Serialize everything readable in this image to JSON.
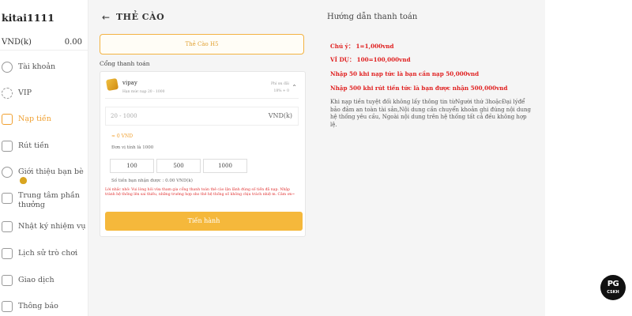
{
  "user": {
    "username": "kitai1111",
    "currency": "VND(k)",
    "balance": "0.00"
  },
  "sidebar": {
    "items": [
      {
        "label": "Tài khoản",
        "icon": "user-icon"
      },
      {
        "label": "VIP",
        "icon": "vip-gear-icon"
      },
      {
        "label": "Nạp tiền",
        "icon": "deposit-icon",
        "active": true
      },
      {
        "label": "Rút tiền",
        "icon": "withdraw-icon"
      },
      {
        "label": "Giới thiệu bạn bè",
        "icon": "referral-icon"
      },
      {
        "label": "Trung tâm phần thưởng",
        "icon": "reward-center-icon"
      },
      {
        "label": "Nhật ký nhiệm vụ",
        "icon": "mission-log-icon"
      },
      {
        "label": "Lịch sử trò chơi",
        "icon": "game-history-icon"
      },
      {
        "label": "Giao dịch",
        "icon": "transaction-icon"
      },
      {
        "label": "Thông báo",
        "icon": "mail-icon"
      }
    ]
  },
  "deposit": {
    "title": "THẺ CÀO",
    "method": "Thẻ Cào H5",
    "gateway_label": "Cổng thanh toán",
    "gateway": {
      "name": "vipay",
      "limit": "Hạn mức nạp 20 - 1000",
      "rate_label": "Phí ưu đãi",
      "rate_value": "18% + 0"
    },
    "amount_placeholder": "20 - 1000",
    "amount_unit": "VND(k)",
    "calc": "≈ 0 VND",
    "unit_note": "Đơn vị tính là 1000",
    "quick_amounts": [
      "100",
      "500",
      "1000"
    ],
    "receive": "Số tiền bạn nhận được : 0.00 VND(k)",
    "warning": "Lời nhắc nhở: Vui lòng hỏi vừa tham gia cổng thanh toán thẻ cào lận lãnh đúng số tiền đã nạp. Nhập tránh hệ thống lên sai thiếu, những trường hợp sho thẻ hệ thống số không chịu trách nhiệ m. Cảm ơn~",
    "submit": "Tiến hành"
  },
  "guide": {
    "title": "Hướng dẫn thanh toán",
    "lines": [
      "Chú ý： 1=1,000vnd",
      "VÍ DỤ： 100=100,000vnd",
      "Nhập 50 khi nạp tức là bạn cần nạp 50,000vnd",
      "Nhập 500 khi rút tiền tức là bạn được nhận 500,000vnd"
    ],
    "body": "Khi nạp tiền tuyệt đối không lấy thông tin từNgười thứ 3hoặcĐại lýđể bảo đảm an toàn tài sản,Nội dung cần chuyển khoản ghi đúng nội dung hệ thống yêu cầu, Ngoài nội dung trên hệ thống tất cả đều không hợp lệ."
  },
  "support": {
    "badge": "PG",
    "label": "CSKH"
  },
  "colors": {
    "accent": "#f5b83b",
    "warning": "#e02020"
  }
}
